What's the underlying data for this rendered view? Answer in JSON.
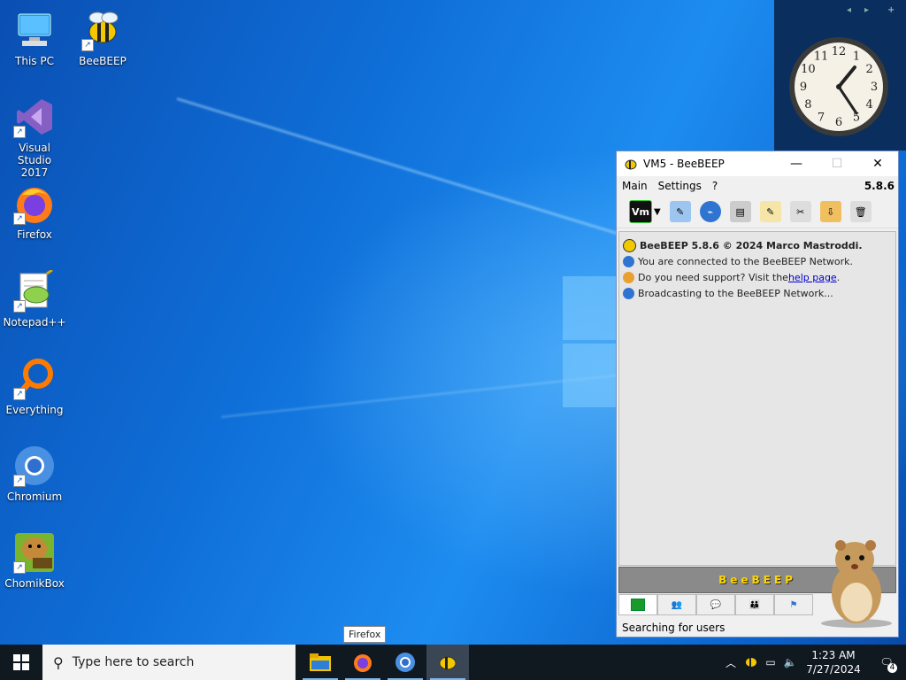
{
  "desktop": {
    "icons": [
      {
        "label": "This PC"
      },
      {
        "label": "BeeBEEP"
      },
      {
        "label": "Visual Studio 2017"
      },
      {
        "label": "Firefox"
      },
      {
        "label": "Notepad++"
      },
      {
        "label": "Everything"
      },
      {
        "label": "Chromium"
      },
      {
        "label": "ChomikBox"
      }
    ]
  },
  "gadget": {
    "nav_prev": "◂",
    "nav_next": "▸",
    "add": "+",
    "clock_time": "1:23",
    "numerals": [
      "12",
      "1",
      "2",
      "3",
      "4",
      "5",
      "6",
      "7",
      "8",
      "9",
      "10",
      "11"
    ]
  },
  "beebeep": {
    "title": "VM5 - BeeBEEP",
    "minimize": "—",
    "maximize": "☐",
    "close": "✕",
    "menu": {
      "main": "Main",
      "settings": "Settings",
      "help": "?",
      "version": "5.8.6"
    },
    "toolbar": {
      "vm_label": "Vm"
    },
    "log": {
      "line1": "BeeBEEP 5.8.6 © 2024 Marco Mastroddi.",
      "line2": "You are connected to the BeeBEEP Network.",
      "line3_pre": "Do you need support? Visit the ",
      "line3_link": "help page",
      "line3_post": ".",
      "line4": "Broadcasting to the BeeBEEP Network..."
    },
    "banner": "BeeBEEP",
    "status": "Searching for users"
  },
  "tooltip": "Firefox",
  "taskbar": {
    "search_placeholder": "Type here to search",
    "time": "1:23 AM",
    "date": "7/27/2024",
    "notifications": "4"
  },
  "colors": {
    "accent": "#0078d7",
    "taskbar": "#101820"
  }
}
